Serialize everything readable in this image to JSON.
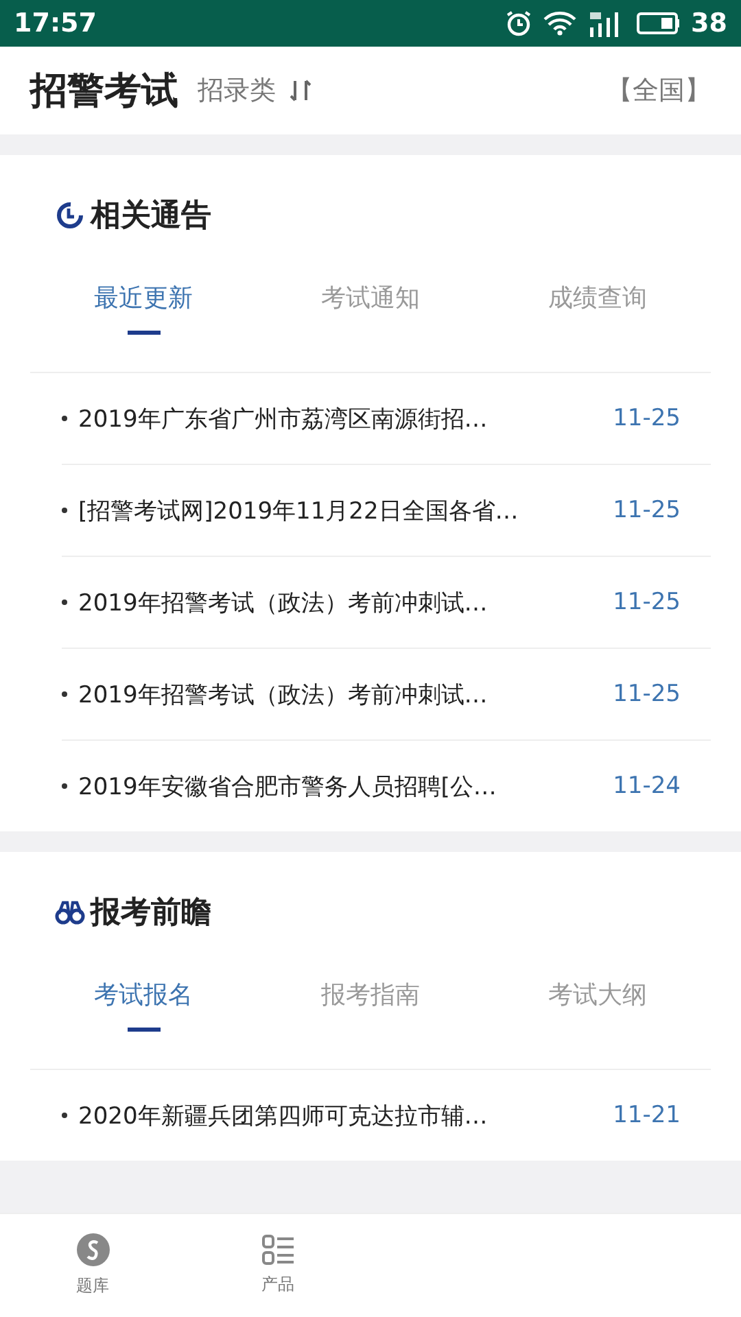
{
  "status_bar": {
    "time": "17:57",
    "battery": "38"
  },
  "header": {
    "title": "招警考试",
    "category": "招录类",
    "region": "【全国】"
  },
  "sections": [
    {
      "title": "相关通告",
      "tabs": [
        {
          "label": "最近更新",
          "selected": true
        },
        {
          "label": "考试通知",
          "selected": false
        },
        {
          "label": "成绩查询",
          "selected": false
        }
      ],
      "items": [
        {
          "title": "2019年广东省广州市荔湾区南源街招…",
          "date": "11-25"
        },
        {
          "title": "[招警考试网]2019年11月22日全国各省…",
          "date": "11-25"
        },
        {
          "title": "2019年招警考试（政法）考前冲刺试…",
          "date": "11-25"
        },
        {
          "title": "2019年招警考试（政法）考前冲刺试…",
          "date": "11-25"
        },
        {
          "title": "2019年安徽省合肥市警务人员招聘[公…",
          "date": "11-24"
        }
      ]
    },
    {
      "title": "报考前瞻",
      "tabs": [
        {
          "label": "考试报名",
          "selected": true
        },
        {
          "label": "报考指南",
          "selected": false
        },
        {
          "label": "考试大纲",
          "selected": false
        }
      ],
      "items": [
        {
          "title": "2020年新疆兵团第四师可克达拉市辅…",
          "date": "11-21"
        }
      ]
    }
  ],
  "nav": [
    {
      "label": "题库"
    },
    {
      "label": "产品"
    }
  ]
}
